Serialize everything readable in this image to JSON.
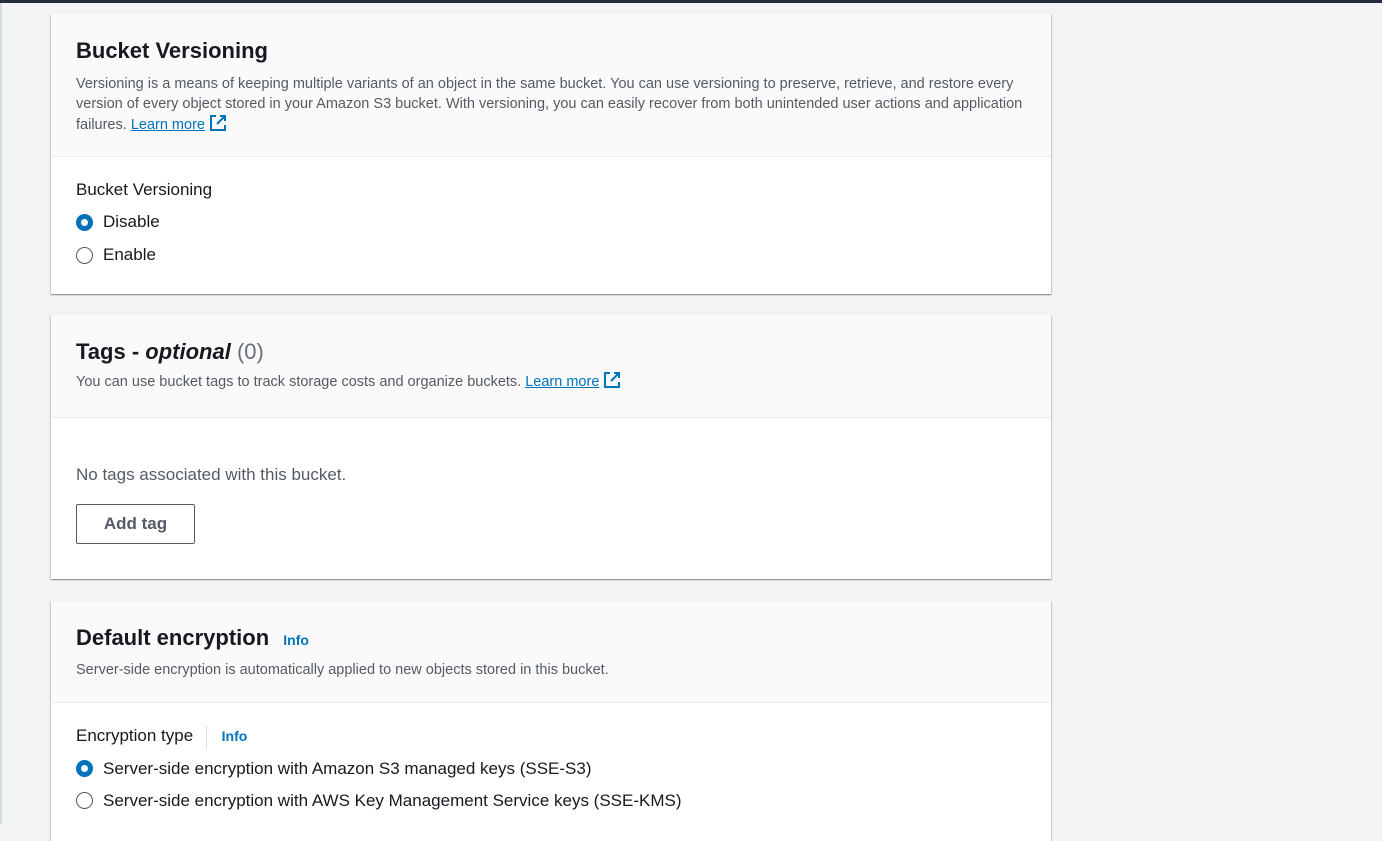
{
  "versioning": {
    "title": "Bucket Versioning",
    "description": "Versioning is a means of keeping multiple variants of an object in the same bucket. You can use versioning to preserve, retrieve, and restore every version of every object stored in your Amazon S3 bucket. With versioning, you can easily recover from both unintended user actions and application failures.",
    "learn_more": "Learn more",
    "field_label": "Bucket Versioning",
    "options": [
      {
        "label": "Disable",
        "selected": true
      },
      {
        "label": "Enable",
        "selected": false
      }
    ]
  },
  "tags": {
    "title_main": "Tags - ",
    "title_optional": "optional",
    "count": "(0)",
    "description": "You can use bucket tags to track storage costs and organize buckets.",
    "learn_more": "Learn more",
    "empty_text": "No tags associated with this bucket.",
    "add_button": "Add tag"
  },
  "encryption": {
    "title": "Default encryption",
    "info": "Info",
    "description": "Server-side encryption is automatically applied to new objects stored in this bucket.",
    "field_label": "Encryption type",
    "field_info": "Info",
    "options": [
      {
        "label": "Server-side encryption with Amazon S3 managed keys (SSE-S3)",
        "selected": true
      },
      {
        "label": "Server-side encryption with AWS Key Management Service keys (SSE-KMS)",
        "selected": false
      }
    ]
  },
  "colors": {
    "accent": "#0073bb",
    "text": "#16191f",
    "muted": "#545b64",
    "page_bg": "#f2f3f3"
  }
}
